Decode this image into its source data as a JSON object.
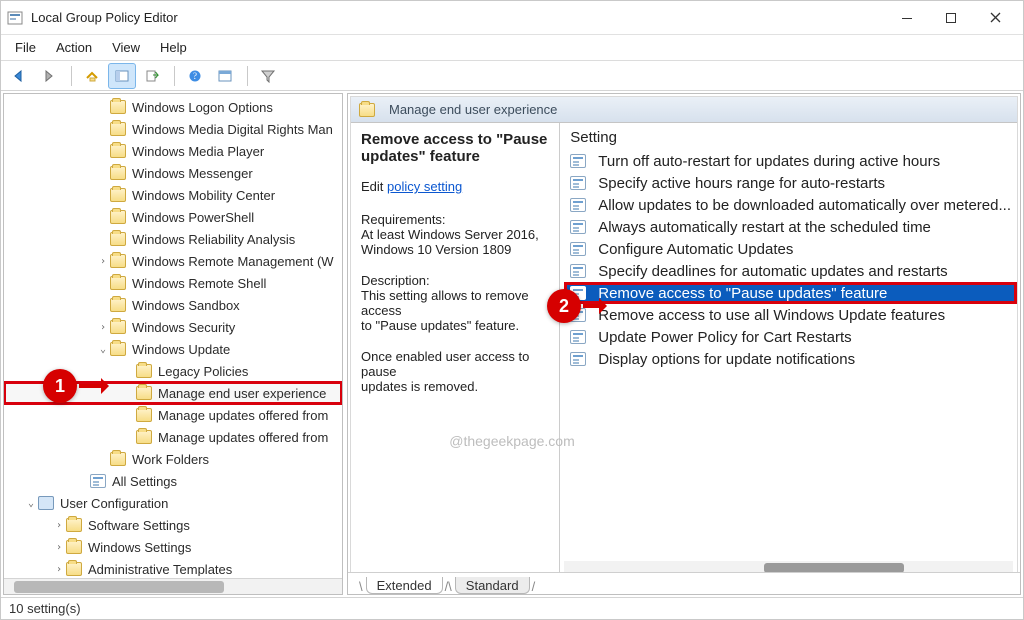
{
  "window": {
    "title": "Local Group Policy Editor"
  },
  "menu": {
    "file": "File",
    "action": "Action",
    "view": "View",
    "help": "Help"
  },
  "tree": {
    "items": [
      {
        "label": "Windows Logon Options",
        "indent": 92
      },
      {
        "label": "Windows Media Digital Rights Man",
        "indent": 92
      },
      {
        "label": "Windows Media Player",
        "indent": 92
      },
      {
        "label": "Windows Messenger",
        "indent": 92
      },
      {
        "label": "Windows Mobility Center",
        "indent": 92
      },
      {
        "label": "Windows PowerShell",
        "indent": 92
      },
      {
        "label": "Windows Reliability Analysis",
        "indent": 92
      },
      {
        "label": "Windows Remote Management (W",
        "indent": 92,
        "twist": ">"
      },
      {
        "label": "Windows Remote Shell",
        "indent": 92
      },
      {
        "label": "Windows Sandbox",
        "indent": 92
      },
      {
        "label": "Windows Security",
        "indent": 92,
        "twist": ">"
      },
      {
        "label": "Windows Update",
        "indent": 92,
        "twist": "v"
      },
      {
        "label": "Legacy Policies",
        "indent": 118
      },
      {
        "label": "Manage end user experience",
        "indent": 118,
        "hl": 1
      },
      {
        "label": "Manage updates offered from",
        "indent": 118
      },
      {
        "label": "Manage updates offered from",
        "indent": 118
      },
      {
        "label": "Work Folders",
        "indent": 92
      },
      {
        "label": "All Settings",
        "indent": 72,
        "icon": "detail"
      },
      {
        "label": "User Configuration",
        "indent": 20,
        "twist": "v",
        "icon": "comp"
      },
      {
        "label": "Software Settings",
        "indent": 48,
        "twist": ">"
      },
      {
        "label": "Windows Settings",
        "indent": 48,
        "twist": ">"
      },
      {
        "label": "Administrative Templates",
        "indent": 48,
        "twist": ">"
      }
    ]
  },
  "details": {
    "header": "Manage end user experience",
    "selected_title": "Remove access to \"Pause updates\" feature",
    "edit_label": "Edit",
    "edit_link": "policy setting",
    "requirements_label": "Requirements:",
    "requirements_lines": [
      "At least Windows Server 2016,",
      "Windows 10 Version 1809"
    ],
    "description_label": "Description:",
    "description_lines": [
      "This setting allows to remove access",
      "to \"Pause updates\" feature."
    ],
    "description_more": [
      "Once enabled user access to pause",
      "updates is removed."
    ],
    "settings_header": "Setting",
    "settings": [
      "Turn off auto-restart for updates during active hours",
      "Specify active hours range for auto-restarts",
      "Allow updates to be downloaded automatically over metered...",
      "Always automatically restart at the scheduled time",
      "Configure Automatic Updates",
      "Specify deadlines for automatic updates and restarts",
      "Remove access to \"Pause updates\" feature",
      "Remove access to use all Windows Update features",
      "Update Power Policy for Cart Restarts",
      "Display options for update notifications"
    ],
    "selected_index": 6
  },
  "tabs": {
    "extended": "Extended",
    "standard": "Standard"
  },
  "status": "10 setting(s)",
  "watermark": "@thegeekpage.com",
  "badges": {
    "one": "1",
    "two": "2"
  }
}
